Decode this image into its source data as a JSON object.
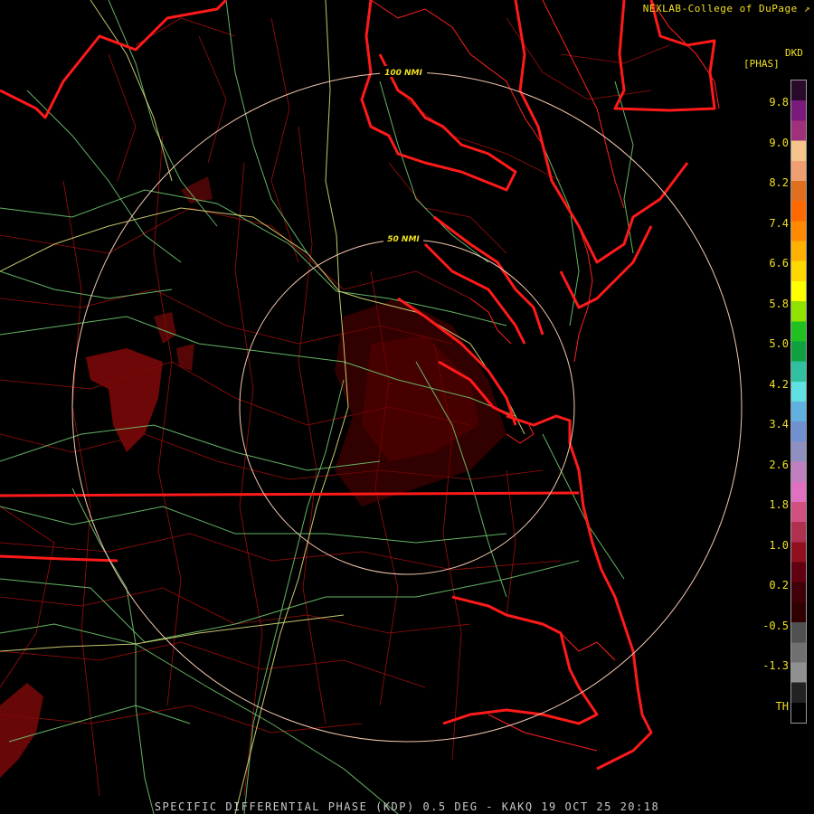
{
  "credit": "NEXLAB-College of DuPage",
  "credit_icon": "external-link-icon",
  "bottom_title": "SPECIFIC DIFFERENTIAL PHASE (KDP) 0.5 DEG - KAKQ 19 OCT 25 20:18",
  "legend": {
    "unit_top": "DKD",
    "unit_bottom": "[PHAS]",
    "ticks": [
      "9.8",
      "9.0",
      "8.2",
      "7.4",
      "6.6",
      "5.8",
      "5.0",
      "4.2",
      "3.4",
      "2.6",
      "1.8",
      "1.0",
      "0.2",
      "-0.5",
      "-1.3",
      "TH"
    ],
    "colors": [
      "#2a0a2a",
      "#7a1a7a",
      "#a0307a",
      "#f4c48a",
      "#f0a070",
      "#e07020",
      "#ff6a00",
      "#ff8a00",
      "#ffb000",
      "#ffd800",
      "#ffff00",
      "#90e000",
      "#20c020",
      "#10a040",
      "#30c0a0",
      "#60e0e0",
      "#60b0e0",
      "#7090d0",
      "#9090c0",
      "#c080c0",
      "#e070c0",
      "#d05080",
      "#b03050",
      "#901020",
      "#600010",
      "#400008",
      "#300000",
      "#505050",
      "#707070",
      "#909090",
      "#222222",
      "#000000"
    ]
  },
  "range_rings": [
    "50 NMI",
    "100 NMI"
  ],
  "colors": {
    "state_border": "#ff1a1a",
    "county_border": "#c01010",
    "highway": "#7ad07a",
    "interstate": "#e8e880",
    "range_ring": "#f4c8b0",
    "label": "#f0e020"
  }
}
